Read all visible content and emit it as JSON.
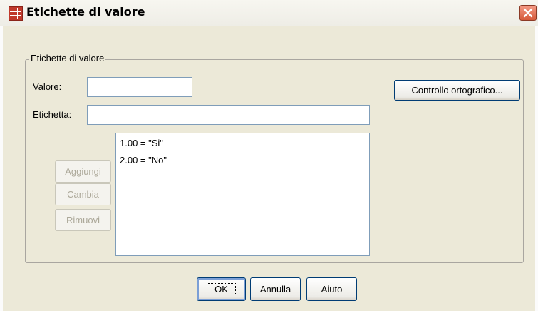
{
  "window": {
    "title": "Etichette di valore",
    "close_icon": "close-icon"
  },
  "group": {
    "legend": "Etichette di valore"
  },
  "value_field": {
    "label": "Valore:",
    "value": ""
  },
  "label_field": {
    "label": "Etichetta:",
    "value": ""
  },
  "spelling_button": "Controllo ortografico...",
  "action_buttons": {
    "add": "Aggiungi",
    "change": "Cambia",
    "remove": "Rimuovi"
  },
  "labels_list": [
    "1.00 = \"Si\"",
    "2.00 = \"No\""
  ],
  "footer": {
    "ok": "OK",
    "cancel": "Annulla",
    "help": "Aiuto"
  }
}
